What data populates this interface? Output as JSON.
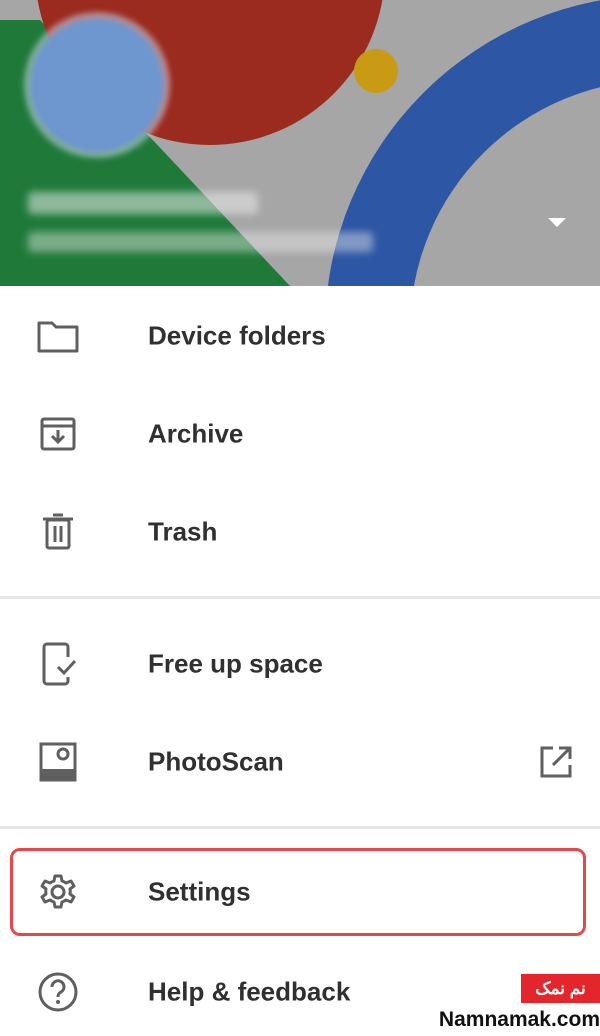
{
  "header": {
    "colors": {
      "background": "#a6a6a6",
      "red": "#9b2a1f",
      "green": "#1f7a3a",
      "blue": "#2d56a5",
      "yellow": "#c99a14"
    }
  },
  "menu": {
    "items": [
      {
        "label": "Device folders",
        "icon": "folder-icon"
      },
      {
        "label": "Archive",
        "icon": "archive-icon"
      },
      {
        "label": "Trash",
        "icon": "trash-icon"
      },
      {
        "label": "Free up space",
        "icon": "phone-check-icon"
      },
      {
        "label": "PhotoScan",
        "icon": "photoscan-icon",
        "trailing_icon": "open-external-icon"
      },
      {
        "label": "Settings",
        "icon": "gear-icon",
        "highlighted": true
      },
      {
        "label": "Help & feedback",
        "icon": "help-icon"
      }
    ]
  },
  "watermark": {
    "badge": "نم نمک",
    "site": "Namnamak.com",
    "color": "#e3262b"
  }
}
